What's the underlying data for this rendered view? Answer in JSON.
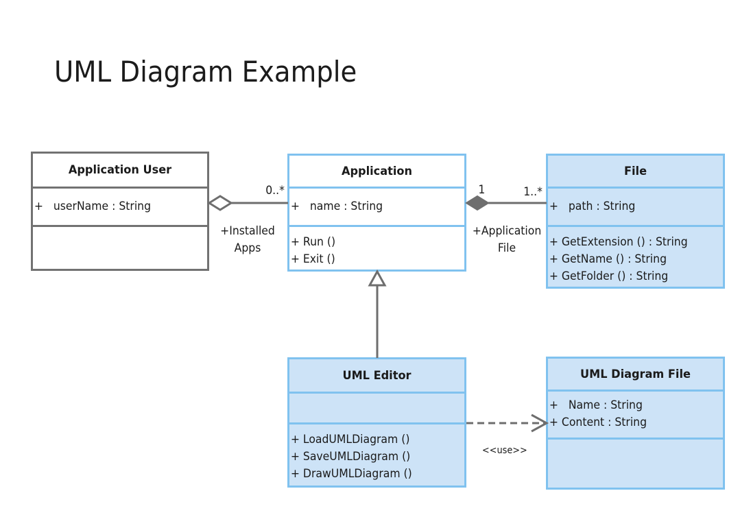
{
  "title": "UML Diagram Example",
  "classes": {
    "application_user": {
      "name": "Application User",
      "attributes": [
        "+   userName : String"
      ],
      "operations": []
    },
    "application": {
      "name": "Application",
      "attributes": [
        "+   name : String"
      ],
      "operations": [
        "+ Run ()",
        "+ Exit ()"
      ]
    },
    "file": {
      "name": "File",
      "attributes": [
        "+   path : String"
      ],
      "operations": [
        "+ GetExtension () : String",
        "+ GetName () : String",
        "+ GetFolder () : String"
      ]
    },
    "uml_editor": {
      "name": "UML Editor",
      "attributes": [],
      "operations": [
        "+ LoadUMLDiagram ()",
        "+ SaveUMLDiagram ()",
        "+ DrawUMLDiagram ()"
      ]
    },
    "uml_diagram_file": {
      "name": "UML Diagram File",
      "attributes": [
        "+   Name : String",
        "+ Content : String"
      ],
      "operations": []
    }
  },
  "relationships": {
    "aggregation": {
      "type": "aggregation",
      "from": "Application User",
      "to": "Application",
      "multiplicity_target": "0..*",
      "role": "+Installed\nApps"
    },
    "composition": {
      "type": "composition",
      "from": "Application",
      "to": "File",
      "multiplicity_source": "1",
      "multiplicity_target": "1..*",
      "role": "+Application\nFile"
    },
    "generalization": {
      "type": "generalization",
      "from": "UML Editor",
      "to": "Application"
    },
    "dependency": {
      "type": "dependency",
      "from": "UML Editor",
      "to": "UML Diagram File",
      "stereotype": "<<use>>"
    }
  },
  "colors": {
    "grey_border": "#727272",
    "blue_border": "#80C2EF",
    "blue_fill": "#CDE3F7",
    "connector": "#6E6E6E"
  }
}
